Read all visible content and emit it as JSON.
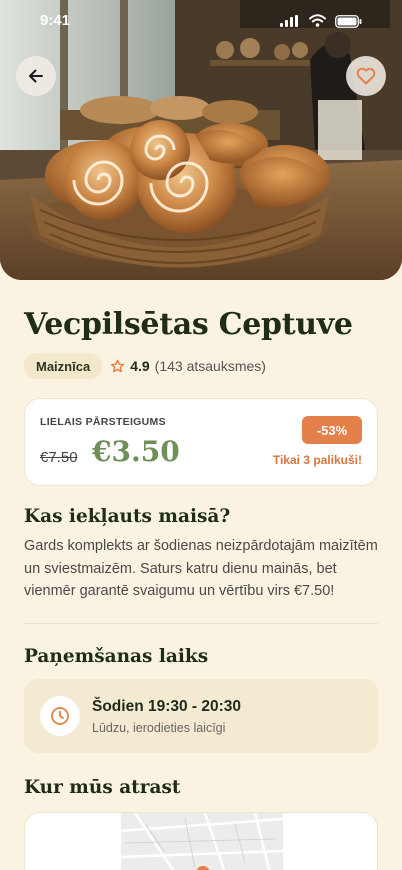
{
  "status_bar": {
    "time": "9:41"
  },
  "colors": {
    "accent": "#E4804A",
    "price_green": "#6E8F58",
    "title_green": "#1E2D14",
    "background": "#FBF3E2"
  },
  "hero": {
    "image": "bakery basket with cinnamon rolls and croissants",
    "back_icon": "arrow-left-icon",
    "favorite_icon": "heart-icon"
  },
  "shop": {
    "name": "Vecpilsētas Ceptuve",
    "category": "Maiznīca",
    "rating": "4.9",
    "reviews": "(143 atsauksmes)"
  },
  "offer": {
    "label": "LIELAIS PĀRSTEIGUMS",
    "old_price": "€7.50",
    "new_price": "€3.50",
    "discount": "-53%",
    "remaining": "Tikai 3 palikuši!"
  },
  "included": {
    "heading": "Kas iekļauts maisā?",
    "description": "Gards komplekts ar šodienas neizpārdotajām maizītēm un sviestmaizēm. Saturs katru dienu mainās, bet vienmēr garantē svaigumu un vērtību virs €7.50!"
  },
  "pickup": {
    "heading": "Paņemšanas laiks",
    "time": "Šodien 19:30 - 20:30",
    "note": "Lūdzu, ierodieties laicīgi"
  },
  "location": {
    "heading": "Kur mūs atrast"
  }
}
